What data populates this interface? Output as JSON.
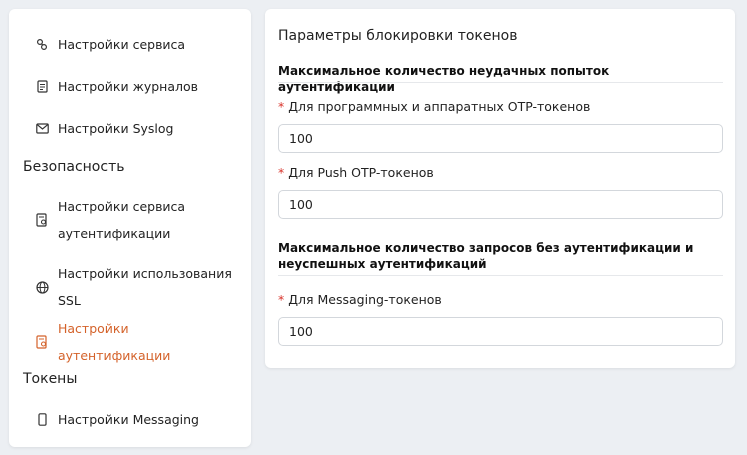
{
  "sidebar": {
    "items_top": [
      {
        "label": "Настройки сервиса",
        "icon": "service-settings-icon"
      },
      {
        "label": "Настройки журналов",
        "icon": "journal-icon"
      },
      {
        "label": "Настройки Syslog",
        "icon": "mail-icon"
      }
    ],
    "group_security": "Безопасность",
    "items_security": [
      {
        "label": "Настройки сервиса аутентификации",
        "icon": "auth-service-icon"
      },
      {
        "label": "Настройки использования SSL",
        "icon": "globe-icon"
      },
      {
        "label": "Настройки аутентификации",
        "icon": "auth-settings-icon"
      }
    ],
    "group_tokens": "Токены",
    "items_tokens": [
      {
        "label": "Настройки Messaging",
        "icon": "phone-icon"
      }
    ],
    "active_color": "#d4622a"
  },
  "panel": {
    "title": "Параметры блокировки токенов",
    "section1": {
      "title": "Максимальное количество неудачных попыток аутентификации",
      "fields": [
        {
          "required_mark": "*",
          "label": "Для программных и аппаратных OTP-токенов",
          "value": "100"
        },
        {
          "required_mark": "*",
          "label": "Для Push OTP-токенов",
          "value": "100"
        }
      ]
    },
    "section2": {
      "title": "Максимальное количество запросов без аутентификации и неуспешных аутентификаций",
      "fields": [
        {
          "required_mark": "*",
          "label": "Для Messaging-токенов",
          "value": "100"
        }
      ]
    }
  }
}
